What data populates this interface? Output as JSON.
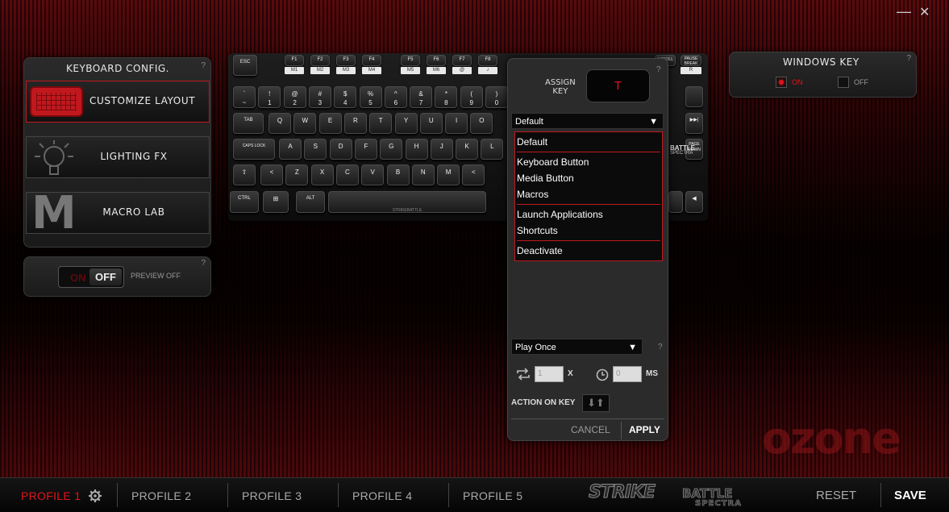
{
  "window": {
    "minimize": "—",
    "close": "✕"
  },
  "keyboard_config": {
    "title": "KEYBOARD CONFIG.",
    "help": "?",
    "items": [
      {
        "label": "CUSTOMIZE LAYOUT",
        "icon": "keyboard-icon",
        "active": true
      },
      {
        "label": "LIGHTING FX",
        "icon": "lightbulb-icon",
        "active": false
      },
      {
        "label": "MACRO LAB",
        "icon": "macro-m-icon",
        "active": false
      }
    ]
  },
  "preview": {
    "on": "ON",
    "off": "OFF",
    "label": "PREVIEW OFF",
    "help": "?"
  },
  "keyboard": {
    "fn_row": [
      "ESC",
      "F1",
      "F2",
      "F3",
      "F4",
      "F5",
      "F6",
      "F7",
      "F8"
    ],
    "fn_labels": [
      "M1",
      "M2",
      "M3",
      "M4",
      "M5",
      "M6",
      "@",
      "♪"
    ],
    "right_top": [
      "SCROLL",
      "PAUSE BREAK"
    ],
    "right_labels": [
      "R"
    ],
    "num_row": [
      "~",
      "1",
      "2",
      "3",
      "4",
      "5",
      "6",
      "7",
      "8",
      "9",
      "0"
    ],
    "num_shift": [
      "`",
      "!",
      "@",
      "#",
      "$",
      "%",
      "^",
      "&",
      "*",
      "(",
      ")"
    ],
    "q_row": [
      "TAB",
      "Q",
      "W",
      "E",
      "R",
      "T",
      "Y",
      "U",
      "I",
      "O"
    ],
    "a_row": [
      "CAPS LOCK",
      "A",
      "S",
      "D",
      "F",
      "G",
      "H",
      "J",
      "K",
      "L"
    ],
    "z_row": [
      "⇧",
      "<",
      "Z",
      "X",
      "C",
      "V",
      "B",
      "N",
      "M",
      "<"
    ],
    "ctrl_row": [
      "CTRL",
      "⊞",
      "ALT"
    ],
    "brand": "STRIKE BATTLE",
    "logo": [
      "BATTLE",
      "SPECTRA"
    ],
    "nav_right": [
      "▶▶|",
      "PAGE DOWN",
      "◀"
    ],
    "space_label": "STRIKEBATTLE"
  },
  "assign": {
    "title_line1": "ASSIGN",
    "title_line2": "KEY",
    "key": "T",
    "help": "?",
    "selected": "Default",
    "options_group1": [
      "Default"
    ],
    "options_group2": [
      "Keyboard Button",
      "Media Button",
      "Macros"
    ],
    "options_group3": [
      "Launch Applications",
      "Shortcuts"
    ],
    "options_group4": [
      "Deactivate"
    ],
    "play_mode": "Play Once",
    "play_help": "?",
    "repeat_value": "1",
    "repeat_unit": "X",
    "delay_value": "0",
    "delay_unit": "MS",
    "action_label": "ACTION ON KEY",
    "cancel": "CANCEL",
    "apply": "APPLY"
  },
  "windows_key": {
    "title": "WINDOWS KEY",
    "on": "ON",
    "off": "OFF",
    "help": "?",
    "state": "on"
  },
  "watermark": "ozone",
  "bottom": {
    "profiles": [
      "PROFILE 1",
      "PROFILE 2",
      "PROFILE 3",
      "PROFILE 4",
      "PROFILE 5"
    ],
    "active_profile": 0,
    "brand_line1": "STRIKE",
    "brand_line2": "BATTLE",
    "brand_line3": "SPECTRA",
    "reset": "RESET",
    "save": "SAVE"
  },
  "colors": {
    "accent": "#c0181e",
    "active_text": "#e0141c"
  }
}
